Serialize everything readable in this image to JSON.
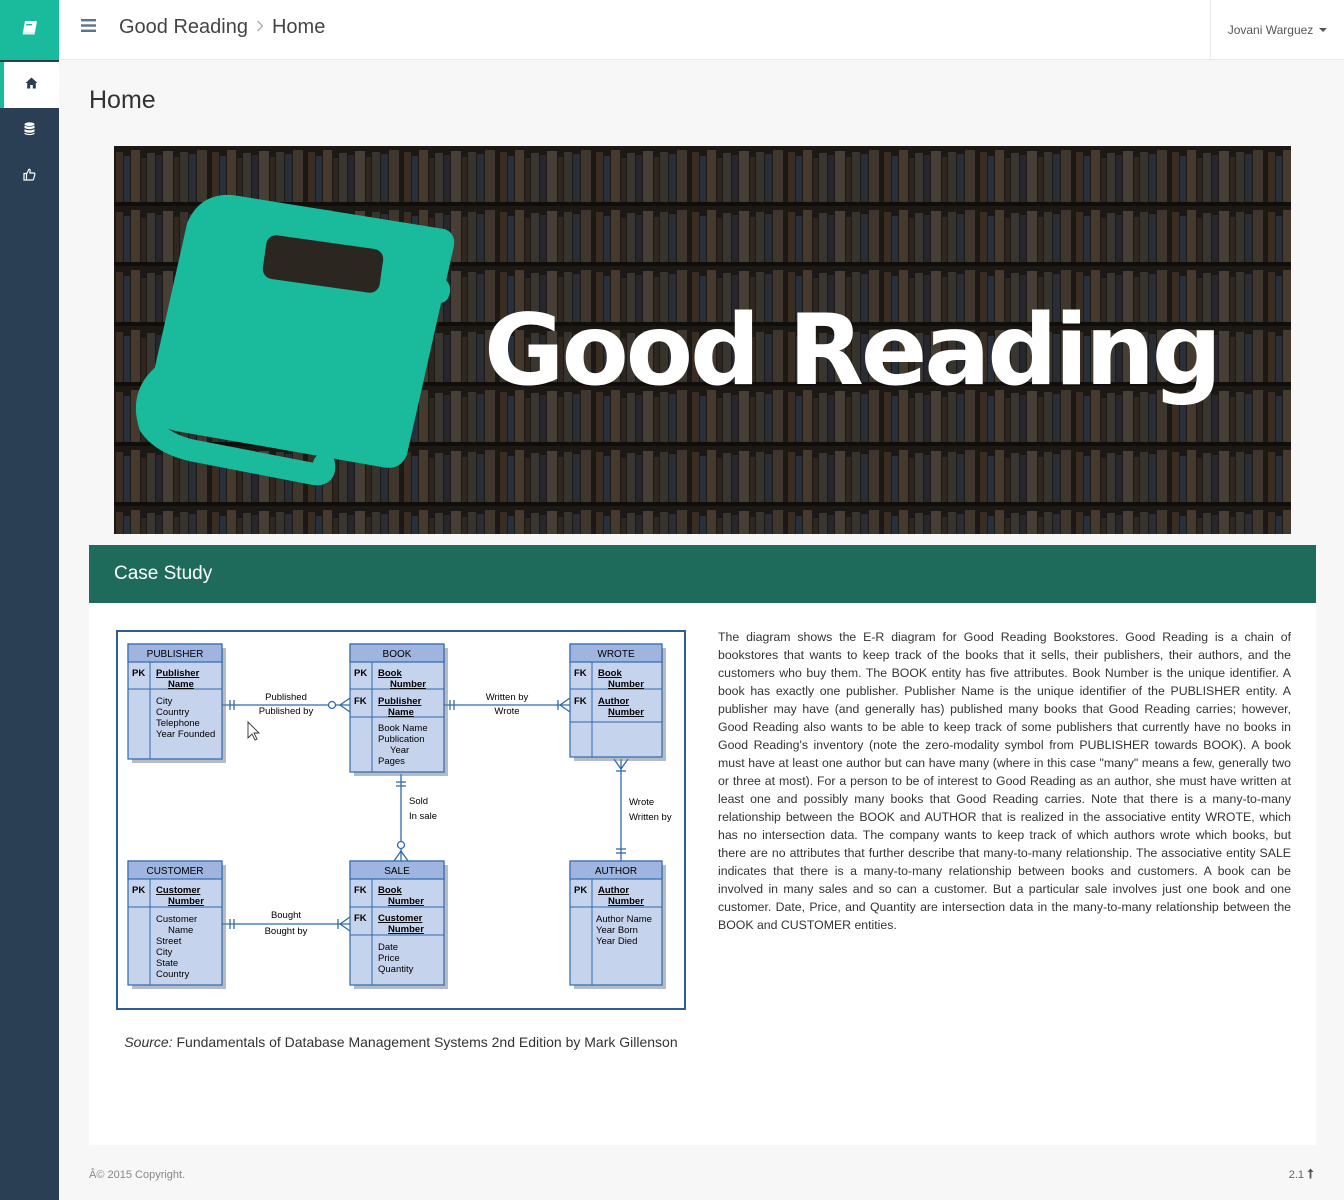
{
  "nav": {
    "items": [
      {
        "icon": "home-icon",
        "active": true
      },
      {
        "icon": "database-icon",
        "active": false
      },
      {
        "icon": "thumbs-up-icon",
        "active": false
      }
    ]
  },
  "header": {
    "breadcrumb": [
      "Good Reading",
      "Home"
    ],
    "user_name": "Jovani Warguez"
  },
  "page_title": "Home",
  "banner": {
    "logo_text": "Good Reading"
  },
  "case_study": {
    "title": "Case Study",
    "caption_source_label": "Source:",
    "caption_text": " Fundamentals of Database Management Systems 2nd Edition by Mark Gillenson",
    "description": "The diagram shows the E-R diagram for Good Reading Bookstores. Good Reading is a chain of bookstores that wants to keep track of the books that it sells, their publishers, their authors, and the customers who buy them. The BOOK entity has five attributes. Book Number is the unique identifier. A book has exactly one publisher. Publisher Name is the unique identifier of the PUBLISHER entity. A publisher may have (and generally has) published many books that Good Reading carries; however, Good Reading also wants to be able to keep track of some publishers that currently have no books in Good Reading's inventory (note the zero-modality symbol from PUBLISHER towards BOOK). A book must have at least one author but can have many (where in this case \"many\" means a few, generally two or three at most). For a person to be of interest to Good Reading as an author, she must have written at least one and possibly many books that Good Reading carries. Note that there is a many-to-many relationship between the BOOK and AUTHOR that is realized in the associative entity WROTE, which has no intersection data. The company wants to keep track of which authors wrote which books, but there are no attributes that further describe that many-to-many relationship. The associative entity SALE indicates that there is a many-to-many relationship between books and customers. A book can be involved in many sales and so can a customer. But a particular sale involves just one book and one customer. Date, Price, and Quantity are intersection data in the many-to-many relationship between the BOOK and CUSTOMER entities."
  },
  "er_diagram": {
    "publisher": {
      "title": "PUBLISHER",
      "pk": "PK",
      "key": [
        "Publisher",
        "Name"
      ],
      "attrs": [
        "City",
        "Country",
        "Telephone",
        "Year Founded"
      ]
    },
    "book": {
      "title": "BOOK",
      "pk": "PK",
      "fk": "FK",
      "key": [
        "Book",
        "Number"
      ],
      "fkey": [
        "Publisher",
        "Name"
      ],
      "attrs": [
        "Book Name",
        "Publication",
        "Year",
        "Pages"
      ]
    },
    "wrote": {
      "title": "WROTE",
      "fk1": "FK",
      "fk2": "FK",
      "key1": [
        "Book",
        "Number"
      ],
      "key2": [
        "Author",
        "Number"
      ]
    },
    "customer": {
      "title": "CUSTOMER",
      "pk": "PK",
      "key": [
        "Customer",
        "Number"
      ],
      "attrs": [
        "Customer",
        "Name",
        "Street",
        "City",
        "State",
        "Country"
      ]
    },
    "sale": {
      "title": "SALE",
      "fk1": "FK",
      "fk2": "FK",
      "key1": [
        "Book",
        "Number"
      ],
      "key2": [
        "Customer",
        "Number"
      ],
      "attrs": [
        "Date",
        "Price",
        "Quantity"
      ]
    },
    "author": {
      "title": "AUTHOR",
      "pk": "PK",
      "key": [
        "Author",
        "Number"
      ],
      "attrs": [
        "Author Name",
        "Year Born",
        "Year Died"
      ]
    },
    "relations": {
      "pub_book": [
        "Published",
        "Published by"
      ],
      "book_wrote": [
        "Written by",
        "Wrote"
      ],
      "book_sale": [
        "Sold",
        "In sale"
      ],
      "wrote_author": [
        "Wrote",
        "Written by"
      ],
      "cust_sale": [
        "Bought",
        "Bought by"
      ]
    }
  },
  "footer": {
    "copyright": "Â© 2015 Copyright.",
    "version": "2.1"
  },
  "colors": {
    "sidebar": "#2a3f54",
    "accent": "#1abb9c",
    "panel_header": "#1e6b5c",
    "entity_fill": "#c6d3ec",
    "entity_header": "#9fb5df",
    "line": "#2e6ab0"
  }
}
